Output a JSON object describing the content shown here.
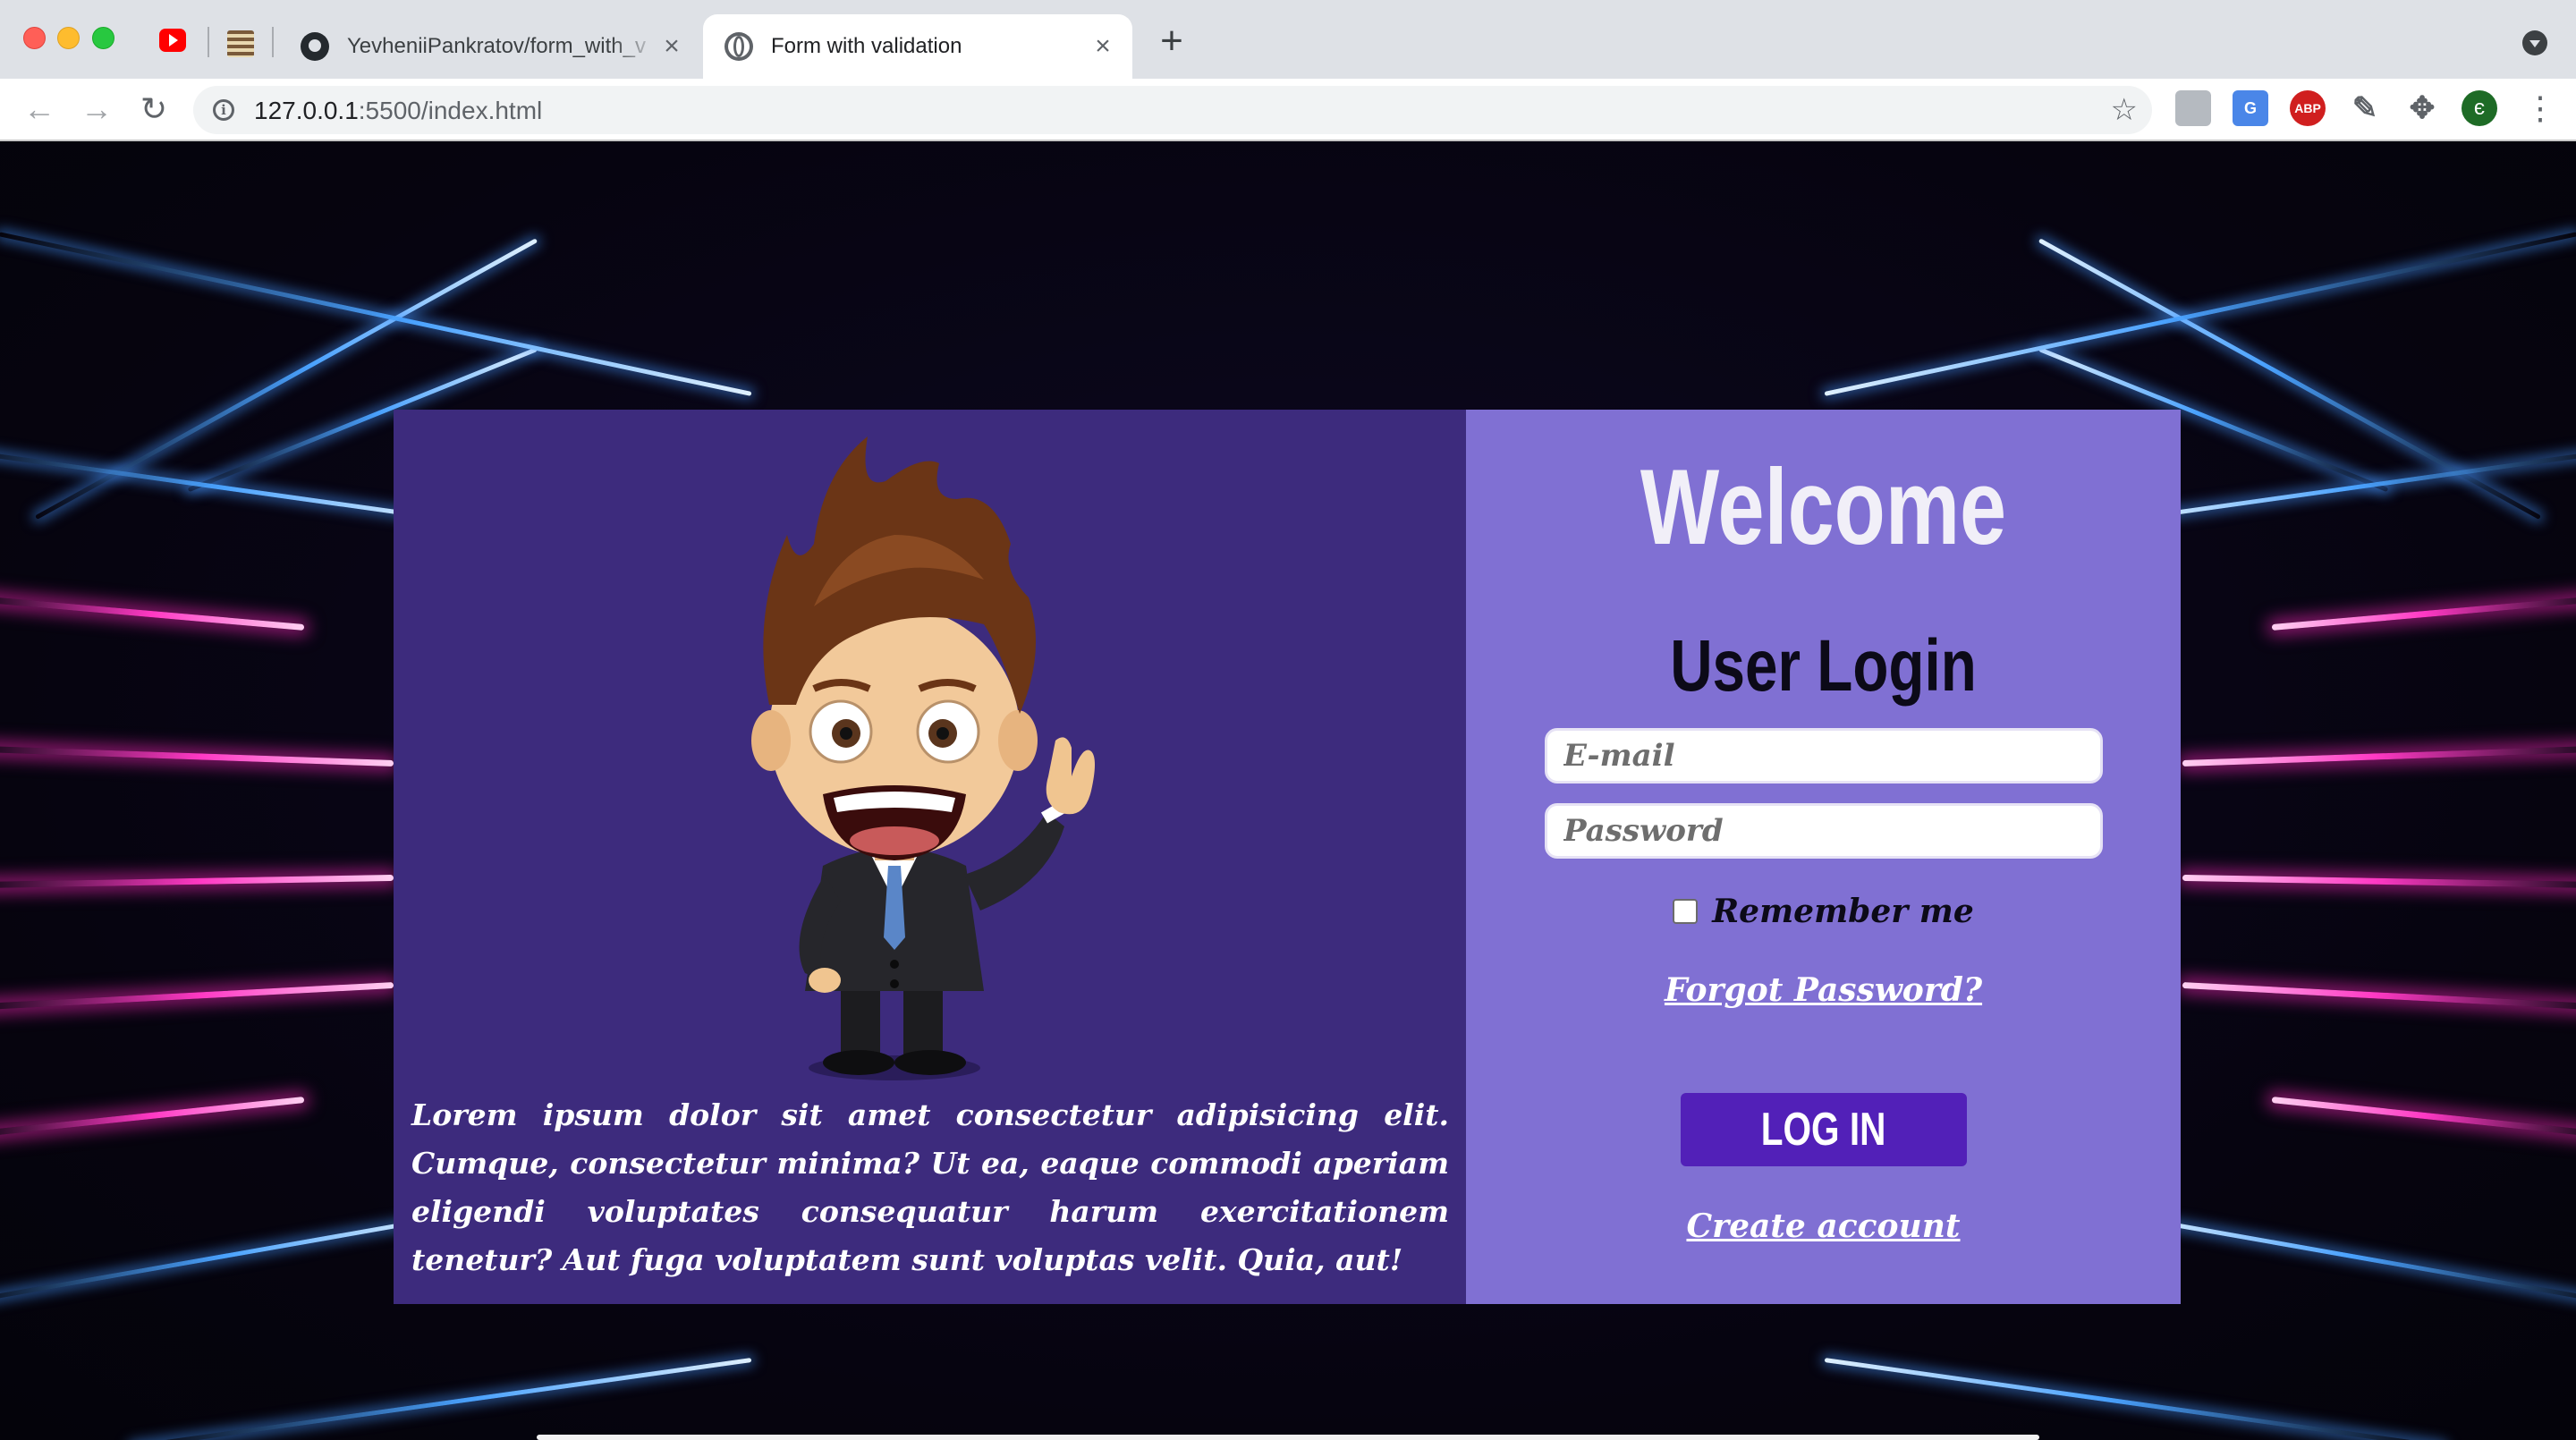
{
  "browser": {
    "tabs": [
      {
        "title": "YevheniiPankratov/form_with_v",
        "active": false
      },
      {
        "title": "Form with validation",
        "active": true
      }
    ],
    "new_tab_label": "+",
    "close_glyph": "×",
    "url": {
      "host": "127.0.0.1",
      "path": ":5500/index.html"
    },
    "extensions": [
      "clipboard-ext",
      "translate-ext",
      "ABP",
      "eyedropper-ext",
      "extensions-puzzle"
    ],
    "avatar_letter": "є",
    "nav": {
      "back": "←",
      "forward": "→",
      "reload": "↻",
      "star": "☆",
      "info": "i",
      "menu": "⋮"
    }
  },
  "page": {
    "hero_text": "Lorem ipsum dolor sit amet consectetur adipisicing elit. Cumque, consectetur minima? Ut ea, eaque commodi aperiam eligendi voluptates consequatur harum exercitationem tenetur? Aut fuga voluptatem sunt voluptas velit. Quia, aut!",
    "welcome": "Welcome",
    "login_title": "User Login",
    "email_placeholder": "E-mail",
    "password_placeholder": "Password",
    "remember_label": "Remember me",
    "forgot_link": "Forgot Password?",
    "login_button": "LOG IN",
    "create_link": "Create account"
  },
  "colors": {
    "card_left": "#3d2b7d",
    "card_right": "#8070d3",
    "button": "#5220b8",
    "neon_pink": "#ff39c4",
    "neon_blue": "#4aa2ff"
  }
}
